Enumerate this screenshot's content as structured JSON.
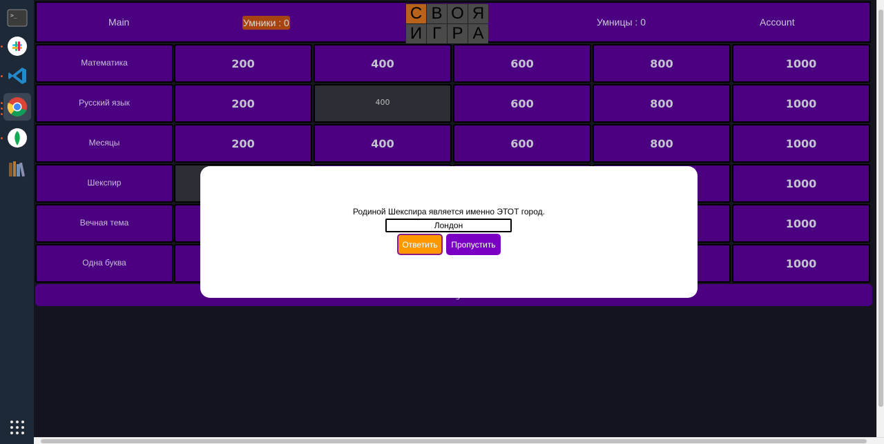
{
  "header": {
    "main_label": "Main",
    "score_left": "Умники : 0",
    "score_right": "Умницы : 0",
    "account_label": "Account",
    "logo_top": [
      "С",
      "В",
      "О",
      "Я"
    ],
    "logo_bottom": [
      "И",
      "Г",
      "Р",
      "А"
    ]
  },
  "categories": [
    "Математика",
    "Русский язык",
    "Месяцы",
    "Шекспир",
    "Вечная тема",
    "Одна буква"
  ],
  "values": [
    "200",
    "400",
    "600",
    "800",
    "1000"
  ],
  "used_cells": [
    {
      "row": 1,
      "col": 1,
      "label": "400"
    },
    {
      "row": 3,
      "col": 0,
      "label": ""
    }
  ],
  "finish_label": "Finish game",
  "modal": {
    "question": "Родиной Шекспира является именно ЭТОТ город.",
    "answer_value": "Лондон",
    "answer_button": "Ответить",
    "skip_button": "Пропустить"
  },
  "colors": {
    "board": "#4b0082",
    "used": "#2a2d34",
    "answer_btn": "#ff9800",
    "skip_btn": "#7a00c4",
    "logo_highlight": "#b8621b"
  }
}
